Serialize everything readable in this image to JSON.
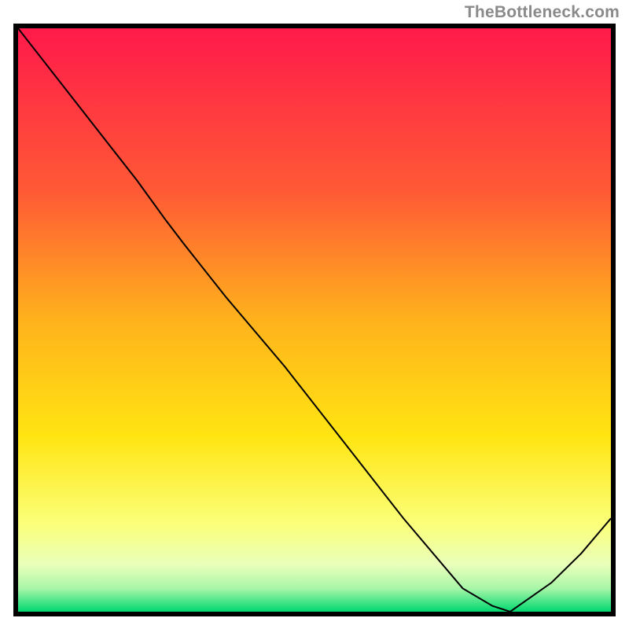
{
  "attribution": "TheBottleneck.com",
  "chart_data": {
    "type": "line",
    "title": "",
    "xlabel": "",
    "ylabel": "",
    "xlim": [
      0,
      100
    ],
    "ylim": [
      0,
      100
    ],
    "note": "Values estimated from curve position; x and y are normalized 0–100 within the framed plot area. Curve descends from top-left, kinks around x≈28, reaches minimum near x≈83 (y≈0), then rises toward the right edge (y≈16).",
    "categories": [
      0,
      5,
      10,
      15,
      20,
      25,
      28,
      35,
      45,
      55,
      65,
      75,
      80,
      83,
      90,
      95,
      100
    ],
    "values": [
      100,
      93.5,
      87,
      80.5,
      74,
      67,
      63,
      54,
      42,
      29,
      16,
      4,
      1,
      0,
      5,
      10,
      16
    ],
    "background_gradient": {
      "stops": [
        {
          "offset": 0.0,
          "color": "#ff1a4b"
        },
        {
          "offset": 0.28,
          "color": "#ff5a35"
        },
        {
          "offset": 0.5,
          "color": "#ffb21c"
        },
        {
          "offset": 0.7,
          "color": "#ffe512"
        },
        {
          "offset": 0.85,
          "color": "#fbff7a"
        },
        {
          "offset": 0.92,
          "color": "#e9ffbb"
        },
        {
          "offset": 0.96,
          "color": "#a8f6a8"
        },
        {
          "offset": 1.0,
          "color": "#00d870"
        }
      ]
    },
    "marker_text": "",
    "marker_color": "#d62c2c",
    "frame_color": "#000000"
  }
}
